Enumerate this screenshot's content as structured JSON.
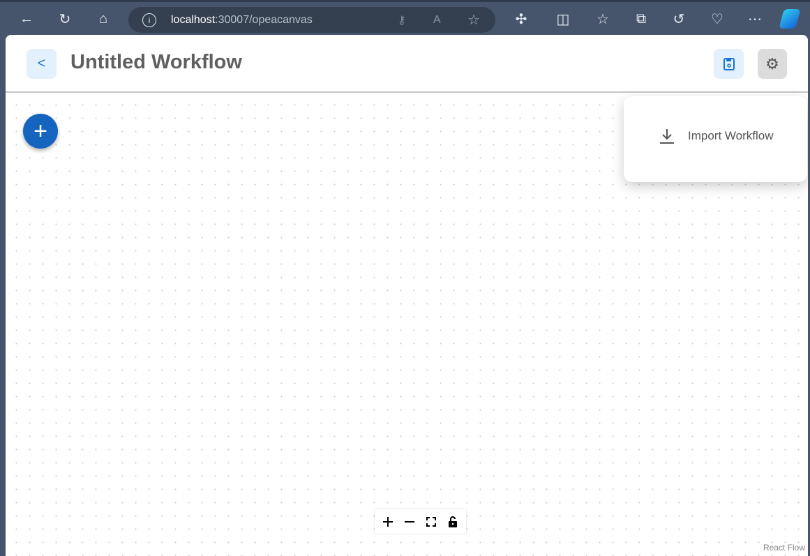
{
  "browser": {
    "url_host": "localhost",
    "url_path": ":30007/opeacanvas"
  },
  "header": {
    "back_label": "<",
    "title": "Untitled Workflow"
  },
  "menu": {
    "items": [
      {
        "label": "Import Workflow",
        "icon": "download-icon"
      }
    ]
  },
  "controls": [
    "zoom-in",
    "zoom-out",
    "fit-view",
    "lock"
  ],
  "attribution": "React Flow",
  "colors": {
    "accent": "#1565c0",
    "save_bg": "#e3f0fd"
  }
}
